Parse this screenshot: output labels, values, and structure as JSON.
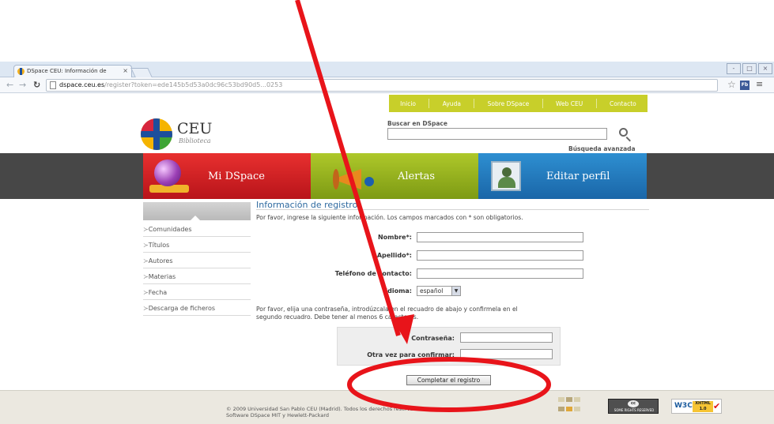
{
  "browser": {
    "tab_title": "DSpace CEU: Información de",
    "tab_close": "×",
    "url_host": "dspace.ceu.es",
    "url_path": "/register?token=ede145b5d53a0dc96c53bd90d5...0253",
    "window_controls": [
      "-",
      "□",
      "×"
    ],
    "extension_label": "Fb"
  },
  "topnav": {
    "items": [
      "Inicio",
      "Ayuda",
      "Sobre DSpace",
      "Web CEU",
      "Contacto"
    ]
  },
  "header": {
    "brand_name": "CEU",
    "brand_sub": "Biblioteca",
    "search_label": "Buscar en DSpace",
    "search_value": "",
    "advanced_search": "Búsqueda avanzada"
  },
  "banner": {
    "items": [
      "Mi DSpace",
      "Alertas",
      "Editar perfil"
    ],
    "colors": [
      "#d7282c",
      "#a2bd22",
      "#2a83c6"
    ]
  },
  "sidebar": {
    "items": [
      "Comunidades",
      "Títulos",
      "Autores",
      "Materias",
      "Fecha",
      "Descarga de ficheros"
    ]
  },
  "form": {
    "title": "Información de registro",
    "intro": "Por favor, ingrese la siguiente información. Los campos marcados con * son obligatorios.",
    "fields": [
      {
        "label": "Nombre*:",
        "value": ""
      },
      {
        "label": "Apellido*:",
        "value": ""
      },
      {
        "label": "Teléfono de contacto:",
        "value": ""
      }
    ],
    "language_label": "Idioma:",
    "language_value": "español",
    "password_instructions_1": "Por favor, elija una contraseña, introdúzcala en el recuadro de abajo y confirmela en el",
    "password_instructions_2": "segundo recuadro. Debe tener al menos 6 caracteres.",
    "password_label": "Contraseña:",
    "password_confirm_label": "Otra vez para confirmar:",
    "submit_label": "Completar el registro"
  },
  "footer": {
    "line1": "© 2009 Universidad San Pablo CEU (Madrid). Todos los derechos reservados",
    "line2": "Software DSpace MIT y Hewlett-Packard",
    "cc_label": "SOME RIGHTS RESERVED",
    "w3c_label": "W3C",
    "xhtml_label": "XHTML 1.0"
  },
  "annotation": {
    "color": "#e8141a"
  }
}
